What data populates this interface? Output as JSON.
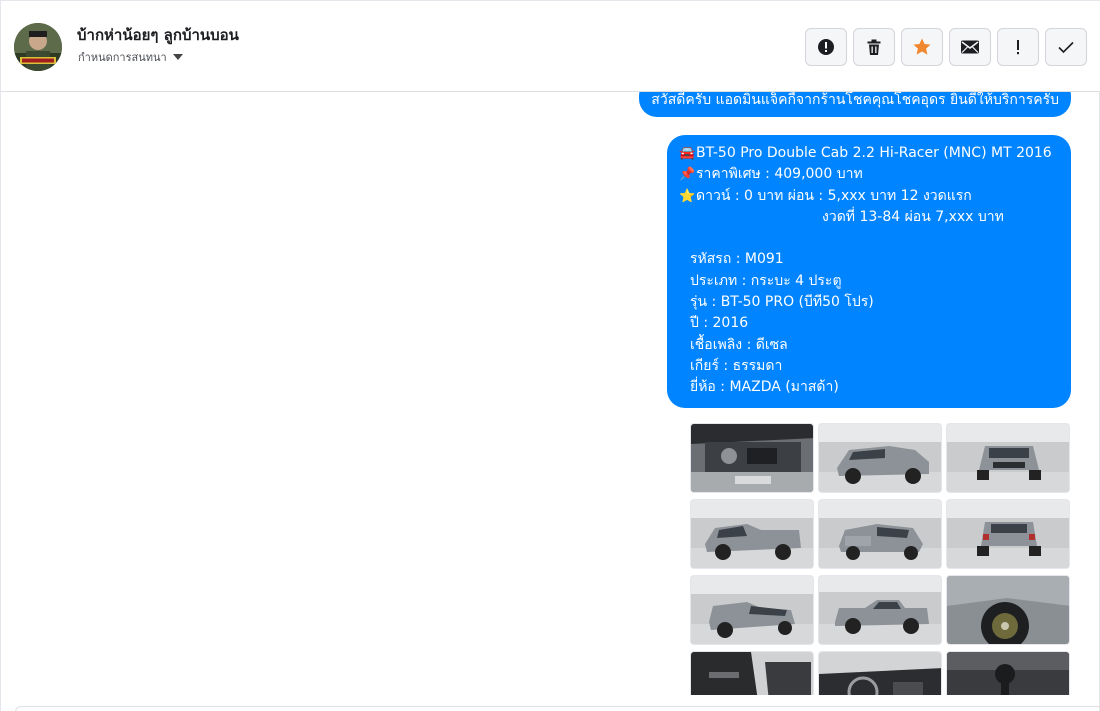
{
  "header": {
    "contact_name": "บ้ากห่าน้อยๆ ลูกบ้านบอน",
    "subtitle": "กำหนดการสนทนา"
  },
  "actions": [
    {
      "name": "report-button",
      "icon": "alert-circle-icon"
    },
    {
      "name": "delete-button",
      "icon": "trash-icon"
    },
    {
      "name": "star-button",
      "icon": "star-icon"
    },
    {
      "name": "mark-unread-button",
      "icon": "envelope-icon"
    },
    {
      "name": "important-button",
      "icon": "exclamation-icon"
    },
    {
      "name": "mark-done-button",
      "icon": "check-icon"
    }
  ],
  "colors": {
    "bubble": "#0084ff",
    "star": "#f0882f"
  },
  "messages": {
    "greeting": "สวัสดีครับ แอดมินแจ็คกี้จากร้านโชคคุณโชคอุดร ยินดีให้บริการครับ",
    "listing": {
      "title": "BT-50 Pro Double Cab 2.2 Hi-Racer (MNC) MT 2016",
      "title_emoji": "🚘",
      "price": "ราคาพิเศษ : 409,000 บาท",
      "price_emoji": "📌",
      "down": "ดาวน์ : 0 บาท ผ่อน : 5,xxx บาท 12 งวดแรก",
      "down_emoji": "⭐",
      "installment": "งวดที่ 13-84 ผ่อน 7,xxx บาท",
      "code": "รหัสรถ : M091",
      "type": "ประเภท : กระบะ 4 ประตู",
      "model": "รุ่น : BT-50 PRO (บีที50 โปร)",
      "year": "ปี : 2016",
      "fuel": "เชื้อเพลิง : ดีเซล",
      "gear": "เกียร์ : ธรรมดา",
      "brand": "ยี่ห้อ : MAZDA (มาสด้า)"
    }
  },
  "photos": [
    {
      "view": "engine-bay"
    },
    {
      "view": "front-three-quarter"
    },
    {
      "view": "front"
    },
    {
      "view": "side-rear-three-quarter"
    },
    {
      "view": "rear-three-quarter"
    },
    {
      "view": "rear"
    },
    {
      "view": "rear-left-three-quarter"
    },
    {
      "view": "side-profile"
    },
    {
      "view": "wheel-closeup"
    },
    {
      "view": "door-interior"
    },
    {
      "view": "dashboard"
    },
    {
      "view": "gear-shifter"
    }
  ]
}
